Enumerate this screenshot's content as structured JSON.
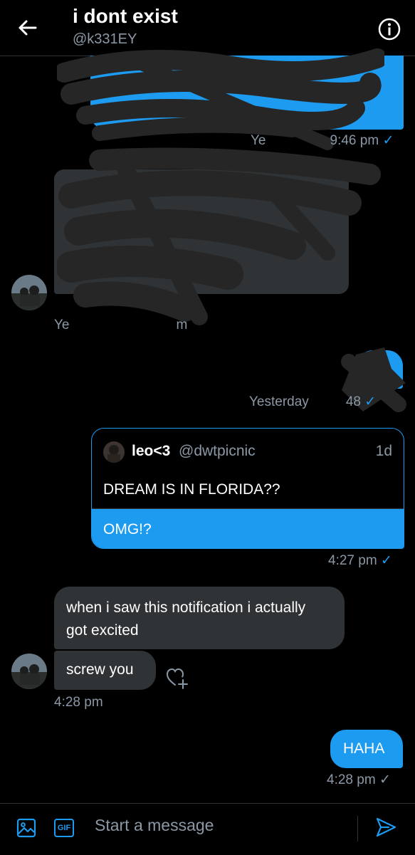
{
  "header": {
    "title": "i dont exist",
    "handle": "@k331EY"
  },
  "messages": {
    "m1_timestamp_prefix": "Ye",
    "m1_timestamp_suffix": "9:46 pm",
    "m2_timestamp_prefix": "Ye",
    "m2_timestamp_suffix": "m",
    "m3_timestamp_prefix": "Yesterday",
    "m3_timestamp_suffix": "48"
  },
  "quoted_tweet": {
    "name": "leo<3",
    "handle": "@dwtpicnic",
    "age": "1d",
    "text": "DREAM IS IN FLORIDA??",
    "reply": "OMG!?",
    "timestamp": "4:27 pm"
  },
  "thread": {
    "msg_excited": "when i saw this notification i actually got excited",
    "msg_screw": "screw you",
    "received_timestamp": "4:28 pm",
    "msg_haha": "HAHA",
    "sent_timestamp": "4:28 pm"
  },
  "composer": {
    "placeholder": "Start a message",
    "gif_label": "GIF"
  },
  "colors": {
    "accent": "#1d9bf0",
    "bubble_gray": "#2f3336",
    "muted_text": "#8b98a5",
    "background": "#000000"
  }
}
